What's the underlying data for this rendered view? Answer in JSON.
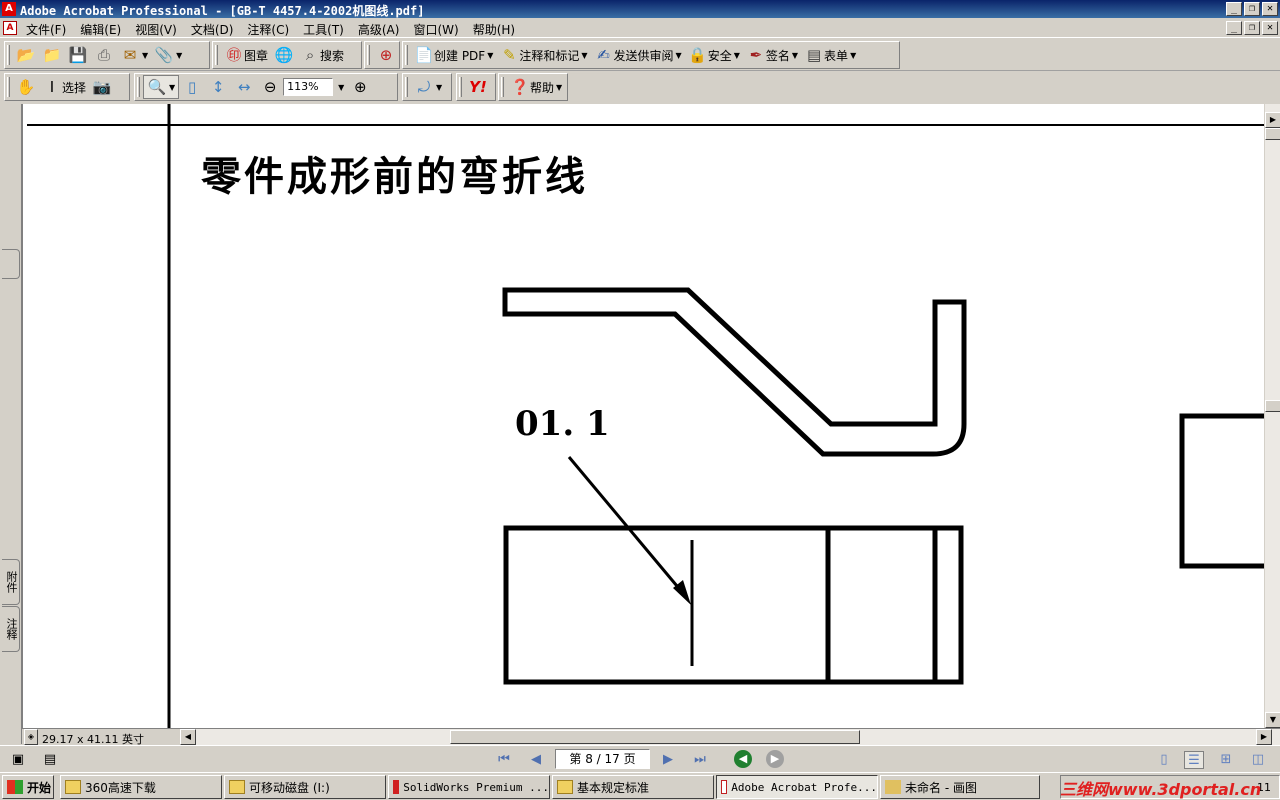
{
  "titlebar": {
    "title": "Adobe Acrobat Professional - [GB-T 4457.4-2002机图线.pdf]",
    "minimize": "_",
    "restore": "❐",
    "close": "✕"
  },
  "menubar": {
    "items": [
      "文件(F)",
      "编辑(E)",
      "视图(V)",
      "文档(D)",
      "注释(C)",
      "工具(T)",
      "高级(A)",
      "窗口(W)",
      "帮助(H)"
    ]
  },
  "toolbar1": {
    "stamp_label": "图章",
    "search_label": "搜索",
    "create_pdf_label": "创建 PDF",
    "comment_label": "注释和标记",
    "review_label": "发送供审阅",
    "security_label": "安全",
    "sign_label": "签名",
    "forms_label": "表单"
  },
  "toolbar2": {
    "select_label": "选择",
    "zoom_value": "113%",
    "help_label": "帮助"
  },
  "leftnav": {
    "attachments_label": "附件",
    "comments_label": "注释"
  },
  "document": {
    "heading": "零件成形前的弯折线",
    "dimension_label": "01. 1"
  },
  "hbar": {
    "page_size": "29.17 x 41.11 英寸"
  },
  "statusbar": {
    "page_indicator": "第 8 / 17 页"
  },
  "taskbar": {
    "start_label": "开始",
    "tasks": [
      "360高速下载",
      "可移动磁盘 (I:)",
      "SolidWorks Premium ...",
      "基本规定标准",
      "Adobe Acrobat Profe...",
      "未命名 - 画图"
    ],
    "watermark": "三维网www.3dportal.cn",
    "clock": "11"
  },
  "colors": {
    "title_gradient_start": "#0a246a",
    "title_gradient_end": "#3a6ea5",
    "chrome": "#d4d0c8",
    "watermark": "#e02020"
  }
}
